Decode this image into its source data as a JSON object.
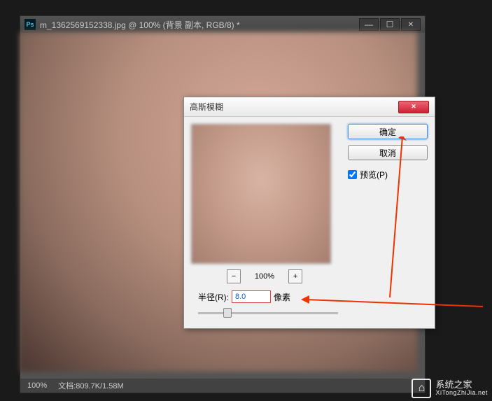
{
  "window": {
    "icon_label": "Ps",
    "title": "m_1362569152338.jpg @ 100% (背景 副本, RGB/8) *"
  },
  "dialog": {
    "title": "高斯模糊",
    "ok_label": "确定",
    "cancel_label": "取消",
    "preview_label": "预览(P)",
    "preview_checked": true,
    "zoom_minus": "−",
    "zoom_value": "100%",
    "zoom_plus": "+",
    "radius_label": "半径(R):",
    "radius_value": "8.0",
    "radius_unit": "像素"
  },
  "statusbar": {
    "zoom": "100%",
    "docinfo_label": "文档:",
    "docinfo_value": "809.7K/1.58M"
  },
  "watermark": {
    "name": "系统之家",
    "url": "XiTongZhiJia.net"
  }
}
